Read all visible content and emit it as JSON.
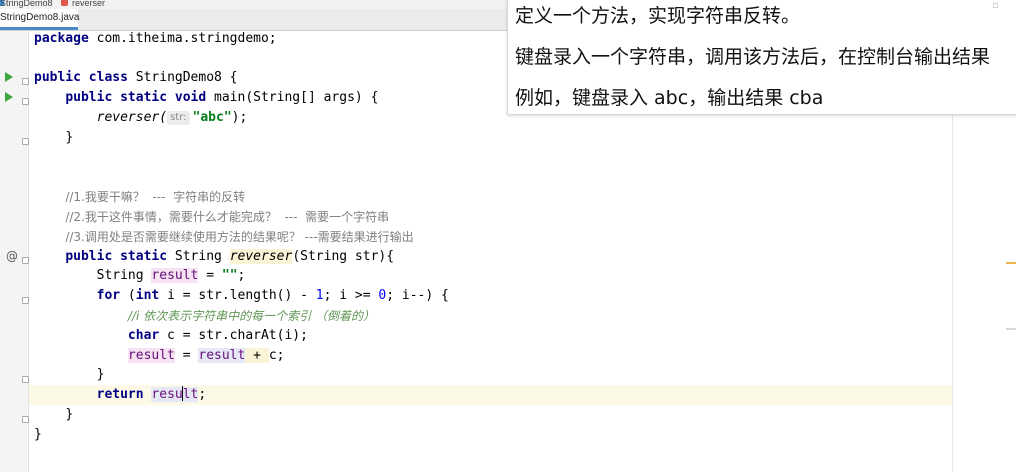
{
  "breadcrumb": {
    "file": "StringDemo8",
    "method": "reverser"
  },
  "tabs": [
    {
      "label": "StringDemo8.java"
    }
  ],
  "code": {
    "line1": {
      "kw": "package",
      "rest": " com.itheima.stringdemo;"
    },
    "line3": {
      "kw1": "public",
      "kw2": "class",
      "rest": " StringDemo8 {"
    },
    "line4": {
      "kw": "public static void",
      "rest": " main(String[] args) {"
    },
    "line5": {
      "call": "reverser(",
      "hint": "str:",
      "arg": "\"abc\"",
      "end": ");"
    },
    "line6": "}",
    "c1": "//1.我要干嘛？  ---  字符串的反转",
    "c2": "//2.我干这件事情，需要什么才能完成？  ---  需要一个字符串",
    "c3": "//3.调用处是否需要继续使用方法的结果呢？ ---需要结果进行输出",
    "line13": {
      "kw": "public static",
      "type": " String ",
      "name": "reverser",
      "rest": "(String str){"
    },
    "line14": {
      "type": "String ",
      "var": "result",
      "eq": " = ",
      "str": "\"\"",
      "end": ";"
    },
    "line15": {
      "kw": "for",
      "p1": " (",
      "kw2": "int",
      "p2": " i = str.length() - ",
      "n1": "1",
      "p3": "; i >= ",
      "n2": "0",
      "p4": "; i--) {"
    },
    "line16": "//i 依次表示字符串中的每一个索引 （倒着的）",
    "line17": {
      "kw": "char",
      "rest": " c = str.charAt(i);"
    },
    "line18": {
      "v1": "result",
      "eq": " = ",
      "v2": "result",
      "op": " + ",
      "rest": "c;"
    },
    "line19": "}",
    "line20": {
      "kw": "return",
      "v_pre": "resu",
      "v_post": "lt",
      "end": ";"
    },
    "line21": "}",
    "line22": "}"
  },
  "overlay": {
    "line1": "定义一个方法，实现字符串反转。",
    "line2": "键盘录入一个字符串，调用该方法后，在控制台输出结果",
    "line3": "例如，键盘录入 abc，输出结果 cba"
  },
  "gutter_icons": [
    "run-icon",
    "run-icon",
    "override-icon"
  ],
  "colors": {
    "keyword": "#000080",
    "string": "#067d17",
    "comment": "#808080",
    "run": "#3ea441",
    "caret_row": "#fcfae6"
  }
}
